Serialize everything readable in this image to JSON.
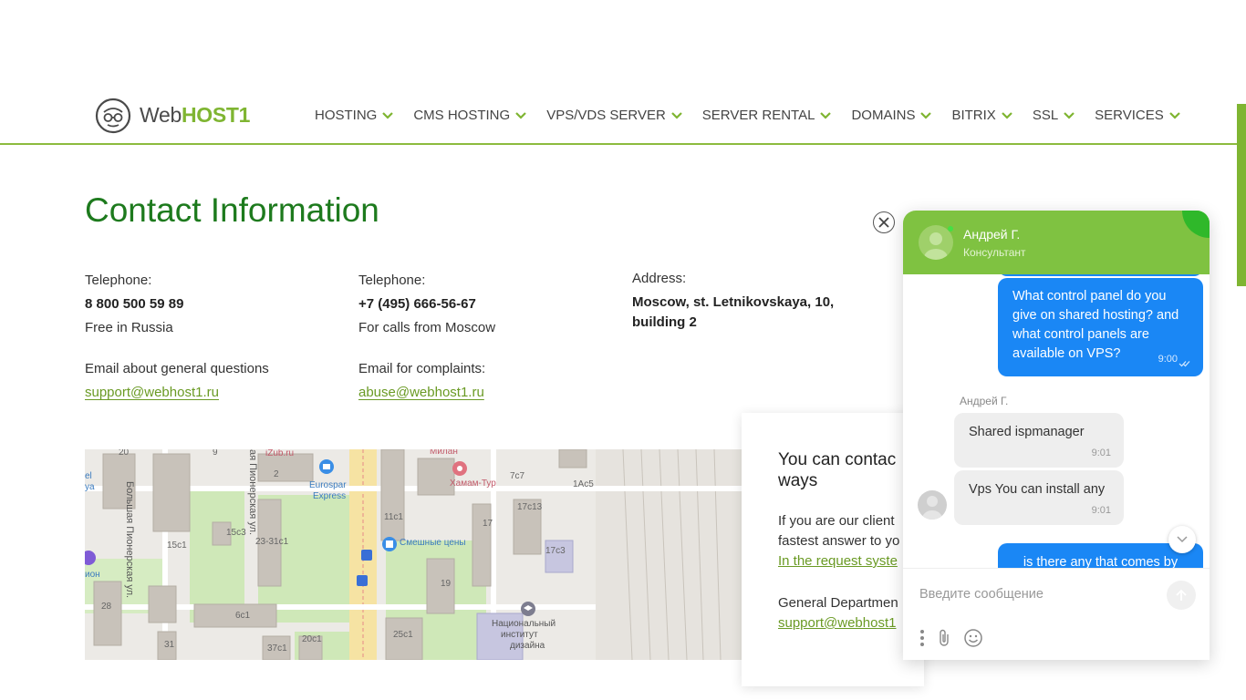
{
  "brand": {
    "web": "Web",
    "host": "HOST1"
  },
  "nav": [
    "HOSTING",
    "CMS HOSTING",
    "VPS/VDS SERVER",
    "SERVER RENTAL",
    "DOMAINS",
    "BITRIX",
    "SSL",
    "SERVICES"
  ],
  "page": {
    "title": "Contact Information"
  },
  "contacts": {
    "tel1": {
      "label": "Telephone:",
      "value": "8 800 500 59 89",
      "note": "Free in Russia"
    },
    "tel2": {
      "label": "Telephone:",
      "value": "+7 (495) 666-56-67",
      "note": "For calls from Moscow"
    },
    "address": {
      "label": "Address:",
      "line1": "Moscow, st. Letnikovskaya, 10,",
      "line2": "building 2"
    },
    "email1": {
      "label": "Email about general questions",
      "value": "support@webhost1.ru"
    },
    "email2": {
      "label": "Email for complaints:",
      "value": "abuse@webhost1.ru"
    }
  },
  "map": {
    "labels": [
      "Большая Пионерская ул.",
      "ая Пионерская ул.",
      "Eurospar",
      "Express",
      "Хамам-Тур",
      "Смешные цены",
      "Национальный",
      "институт",
      "дизайна",
      "iZub.ru",
      "Милан",
      "20",
      "2",
      "9",
      "15c1",
      "15c3",
      "23-31c1",
      "11c1",
      "7c7",
      "17c13",
      "1Ac5",
      "17",
      "17c3",
      "19",
      "28",
      "6c1",
      "31",
      "37c1",
      "20c1",
      "25c1",
      "ион",
      "el",
      "ya"
    ]
  },
  "contact_card": {
    "title_line1": "You can contac",
    "title_line2": "ways",
    "text1": "If you are our client",
    "text2": "fastest answer to yo",
    "link1": "In the request syste",
    "dept": "General Departmen",
    "link2": "support@webhost1"
  },
  "chat": {
    "agent_name": "Андрей Г.",
    "agent_role": "Консультант",
    "messages": {
      "out1": {
        "text": "What control panel do you give on shared hosting? and what control panels are available on VPS?",
        "time": "9:00"
      },
      "sender": "Андрей Г.",
      "in1": {
        "text": "Shared ispmanager",
        "time": "9:01"
      },
      "in2": {
        "text": "Vps You can install any",
        "time": "9:01"
      },
      "out2": {
        "text": "is there any that comes by"
      }
    },
    "input_placeholder": "Введите сообщение"
  },
  "colors": {
    "accent": "#7fb532",
    "title_green": "#1d7a1d",
    "chat_blue": "#1a87f5",
    "chat_header": "#7fc241"
  }
}
